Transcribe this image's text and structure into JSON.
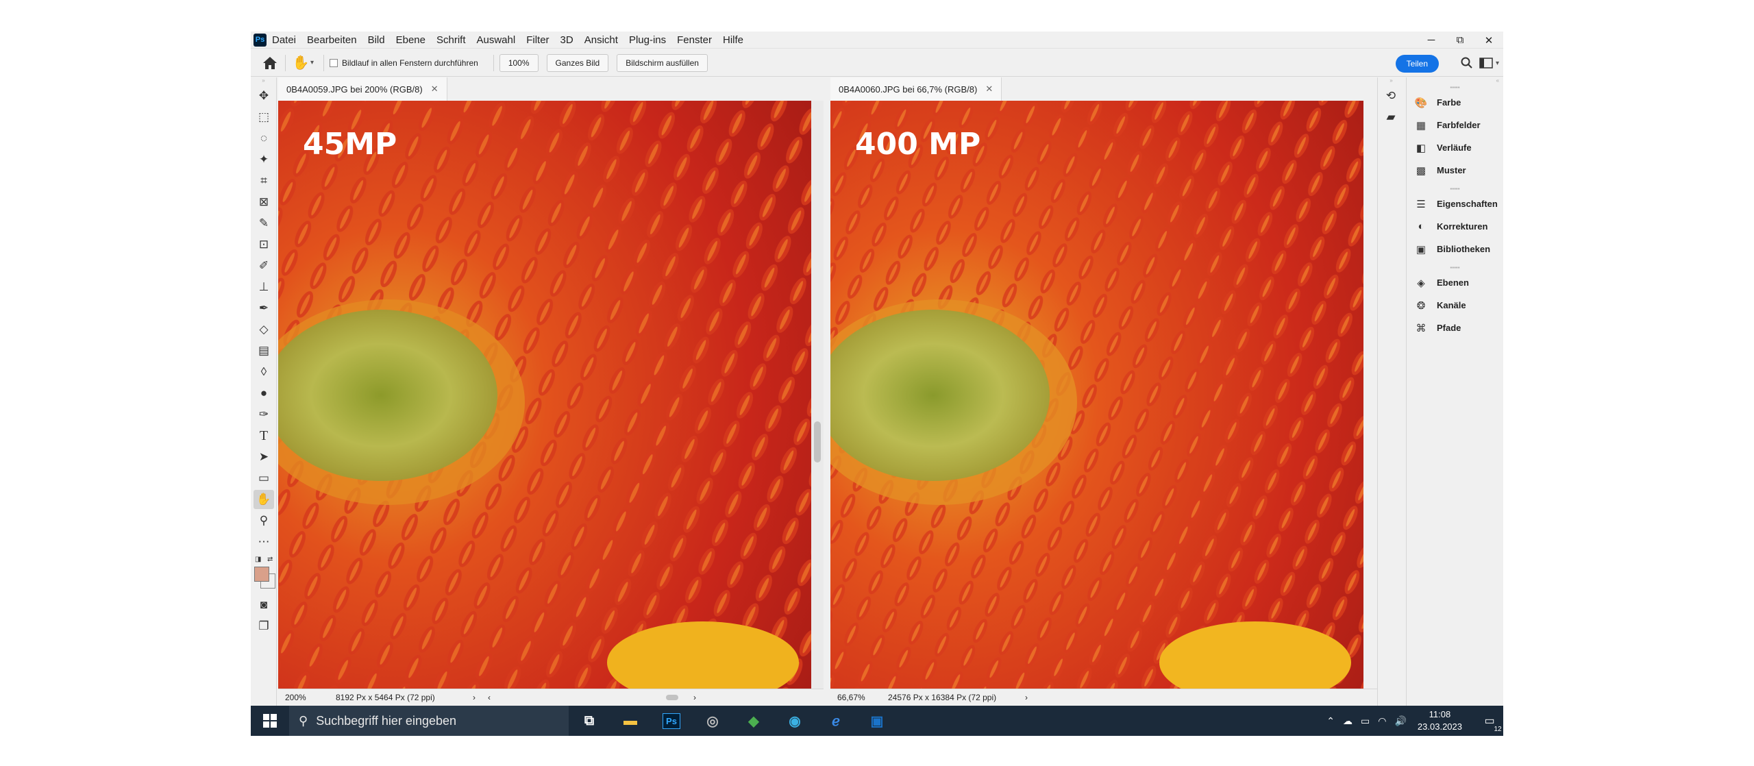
{
  "app": {
    "logo": "Ps"
  },
  "menu": [
    "Datei",
    "Bearbeiten",
    "Bild",
    "Ebene",
    "Schrift",
    "Auswahl",
    "Filter",
    "3D",
    "Ansicht",
    "Plug-ins",
    "Fenster",
    "Hilfe"
  ],
  "window_controls": {
    "minimize": "─",
    "restore": "⧉",
    "close": "✕"
  },
  "options": {
    "scroll_all_label": "Bildlauf in allen Fenstern durchführen",
    "zoom_value": "100%",
    "fit_btn": "Ganzes Bild",
    "fill_btn": "Bildschirm ausfüllen",
    "share_btn": "Teilen"
  },
  "tools": [
    "move-icon",
    "marquee-icon",
    "lasso-icon",
    "magic-wand-icon",
    "crop-icon",
    "frame-icon",
    "eyedropper-icon",
    "patch-icon",
    "brush-icon",
    "stamp-icon",
    "history-brush-icon",
    "eraser-icon",
    "gradient-icon",
    "blur-icon",
    "dodge-icon",
    "pen-icon",
    "type-icon",
    "path-select-icon",
    "rectangle-icon",
    "hand-icon",
    "zoom-icon",
    "more-icon"
  ],
  "colors": {
    "foreground": "#d9a08a",
    "background": "#ffffff",
    "accent": "#1473e6",
    "taskbar": "#1b2a3a"
  },
  "documents": [
    {
      "title": "0B4A0059.JPG bei 200% (RGB/8)",
      "zoom": "200%",
      "info": "8192 Px x 5464 Px (72 ppi)",
      "label": "45MP"
    },
    {
      "title": "0B4A0060.JPG bei 66,7% (RGB/8)",
      "zoom": "66,67%",
      "info": "24576 Px x 16384 Px (72 ppi)",
      "label": "400 MP"
    }
  ],
  "panels": [
    [
      {
        "icon": "palette-icon",
        "label": "Farbe"
      },
      {
        "icon": "grid-icon",
        "label": "Farbfelder"
      },
      {
        "icon": "gradient-icon",
        "label": "Verläufe"
      },
      {
        "icon": "pattern-icon",
        "label": "Muster"
      }
    ],
    [
      {
        "icon": "sliders-icon",
        "label": "Eigenschaften"
      },
      {
        "icon": "adjust-icon",
        "label": "Korrekturen"
      },
      {
        "icon": "library-icon",
        "label": "Bibliotheken"
      }
    ],
    [
      {
        "icon": "layers-icon",
        "label": "Ebenen"
      },
      {
        "icon": "channels-icon",
        "label": "Kanäle"
      },
      {
        "icon": "paths-icon",
        "label": "Pfade"
      }
    ]
  ],
  "taskbar": {
    "search_placeholder": "Suchbegriff hier eingeben",
    "apps": [
      "task-view-icon",
      "explorer-icon",
      "photoshop-icon",
      "camera-app-icon",
      "green-app-icon",
      "edge-icon",
      "ie-icon",
      "outlook-icon"
    ],
    "time": "11:08",
    "date": "23.03.2023",
    "notifications": "12"
  }
}
